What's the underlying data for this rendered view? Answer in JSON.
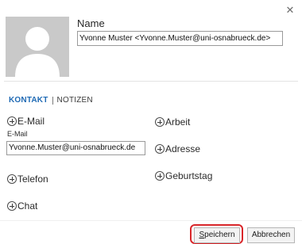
{
  "window": {
    "close_glyph": "✕"
  },
  "contact": {
    "name_label": "Name",
    "name_value": "Yvonne Muster <Yvonne.Muster@uni-osnabrueck.de>"
  },
  "tabs": [
    {
      "label": "KONTAKT",
      "active": true
    },
    {
      "label": "NOTIZEN",
      "active": false
    }
  ],
  "fields": {
    "email": {
      "add_label": "E-Mail",
      "label": "E-Mail",
      "value": "Yvonne.Muster@uni-osnabrueck.de"
    },
    "arbeit": {
      "add_label": "Arbeit"
    },
    "adresse": {
      "add_label": "Adresse"
    },
    "telefon": {
      "add_label": "Telefon"
    },
    "geburtstag": {
      "add_label": "Geburtstag"
    },
    "chat": {
      "add_label": "Chat"
    }
  },
  "buttons": {
    "save_first": "S",
    "save_rest": "peichern",
    "cancel": "Abbrechen"
  },
  "colors": {
    "accent": "#1f6ab4",
    "highlight": "#d9262a"
  }
}
